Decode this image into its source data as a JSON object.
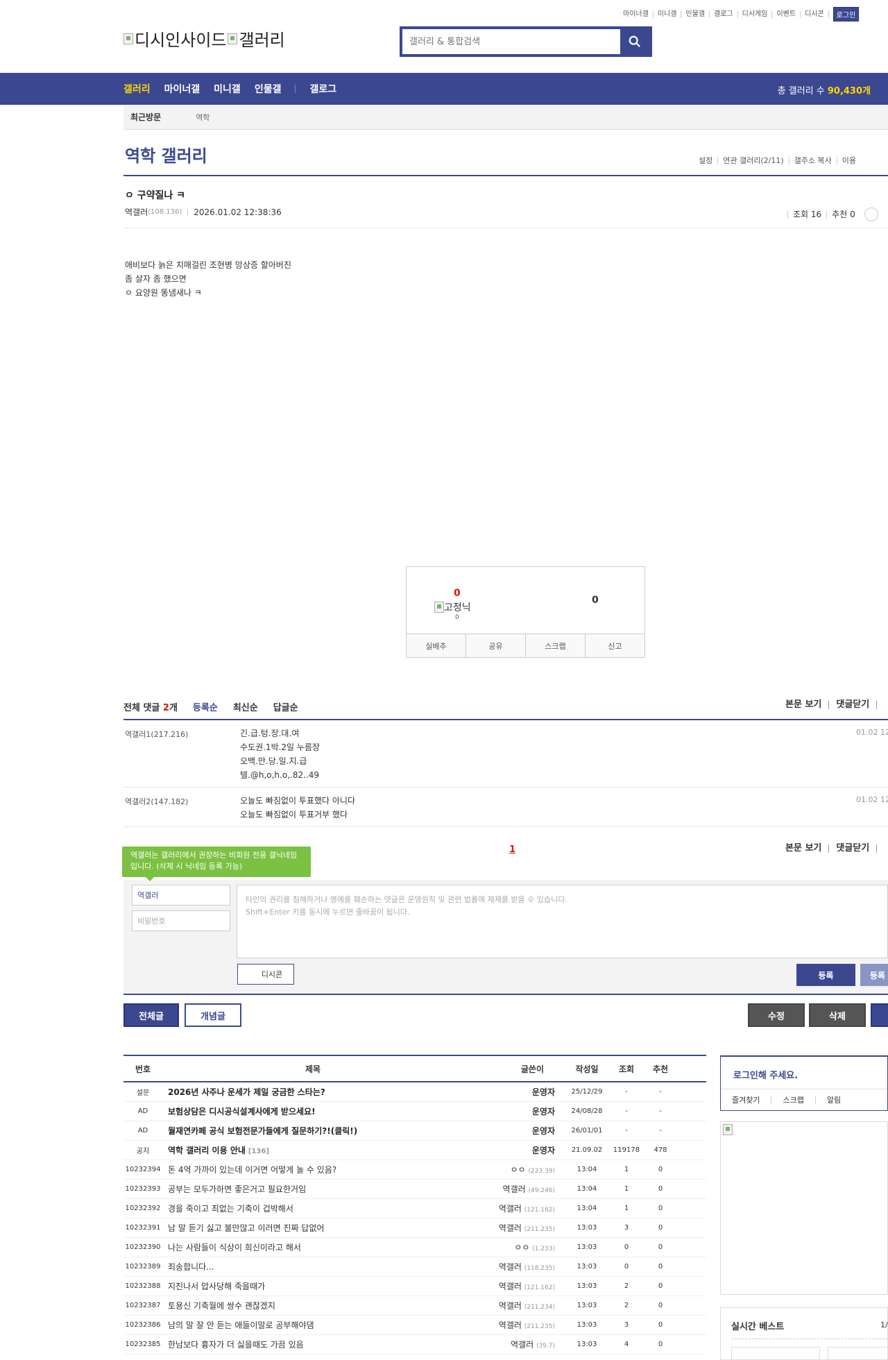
{
  "top_links": [
    "마이너갤",
    "미니갤",
    "인물갤",
    "갤로그",
    "디시게임",
    "이벤트",
    "디시콘"
  ],
  "login_label": "로그인",
  "logo": {
    "alt1": "디시인사이드",
    "alt2": "갤러리"
  },
  "search": {
    "placeholder": "갤러리 & 통합검색"
  },
  "nav": {
    "items": [
      "갤러리",
      "마이너갤",
      "미니갤",
      "인물갤",
      "갤로그"
    ],
    "total_label": "총 갤러리 수",
    "total_value": "90,430개"
  },
  "subbar": {
    "recent": "최근방문",
    "item": "역학"
  },
  "gallery": {
    "title": "역학 갤러리",
    "menu": [
      "설정",
      "연관 갤러리(2/11)",
      "갤주소 복사",
      "이용"
    ]
  },
  "post": {
    "title": "ㅇ 구약질나 ㅋ",
    "author": "역갤러",
    "ip": "(108.136)",
    "datetime": "2026.01.02 12:38:36",
    "views": "조회 16",
    "recommend": "추천 0",
    "body": [
      "애비보다 늙은 치매걸린 조현병 망상증 할아버진",
      "좀 살자 좀 했으면",
      "ㅇ  요양원 똥냄새나 ㅋ"
    ]
  },
  "recommend_box": {
    "up": "0",
    "fixnick_alt": "고정닉",
    "fixnick_count": "0",
    "down": "0",
    "buttons": [
      "실베추",
      "공유",
      "스크랩",
      "신고"
    ]
  },
  "comments_header": {
    "total_prefix": "전체 댓글",
    "total_count": "2",
    "total_suffix": "개",
    "sorts": [
      "등록순",
      "최신순",
      "답글순"
    ],
    "right": [
      "본문 보기",
      "댓글닫기"
    ]
  },
  "comments": [
    {
      "nick": "역갤러1",
      "ip": "(217.216)",
      "lines": [
        "긴.급.텅.장.대.여",
        "수도권.1박.2일 누름장",
        "오백.만.당.일.지.급",
        "텔.@h,o,h.o,.82..49"
      ],
      "date": "01.02 12"
    },
    {
      "nick": "역갤러2",
      "ip": "(147.182)",
      "lines": [
        "오늘도 빠짐없이 투표했다 아니다",
        "오늘도 빠짐없이 투표거부 했다"
      ],
      "date": "01.02 12"
    }
  ],
  "comment_pager": "1",
  "comment_footer_right": [
    "본문 보기",
    "댓글닫기"
  ],
  "write": {
    "tip": "역갤러는 갤러리에서 권장하는 비회원 전용 갤닉네임입니다. (삭제 시 닉네임 등록 가능)",
    "nick_value": "역갤러",
    "password_placeholder": "비밀번호",
    "textarea_line1": "타인의 권리를 침해하거나 명예를 훼손하는 댓글은 운영원칙 및 관련 법률에 제재를 받을 수 있습니다.",
    "textarea_line2": "Shift+Enter 키를 동시에 누르면 줄바꿈이 됩니다.",
    "dcon": "디시콘",
    "register": "등록",
    "register2": "등록"
  },
  "bottom_buttons": {
    "all": "전체글",
    "concept": "개념글",
    "edit": "수정",
    "delete": "삭제"
  },
  "list": {
    "headers": {
      "no": "번호",
      "title": "제목",
      "writer": "글쓴이",
      "date": "작성일",
      "views": "조회",
      "rec": "추천"
    },
    "rows": [
      {
        "no": "설문",
        "title": "2026년 사주나 운세가 제일 궁금한 스타는?",
        "count": "",
        "writer": "운영자",
        "ip": "",
        "date": "25/12/29",
        "views": "-",
        "rec": "-",
        "notice": true
      },
      {
        "no": "AD",
        "title": "보험상담은 디시공식설계사에게 받으세요!",
        "count": "",
        "writer": "운영자",
        "ip": "",
        "date": "24/08/28",
        "views": "-",
        "rec": "-",
        "notice": true
      },
      {
        "no": "AD",
        "title": "월재연카페 공식 보험전문가들에게 질문하기?!(클릭!)",
        "count": "",
        "writer": "운영자",
        "ip": "",
        "date": "26/01/01",
        "views": "-",
        "rec": "-",
        "notice": true
      },
      {
        "no": "공지",
        "title": "역학 갤러리 이용 안내",
        "count": "[136]",
        "writer": "운영자",
        "ip": "",
        "date": "21.09.02",
        "views": "119178",
        "rec": "478",
        "notice": true
      },
      {
        "no": "10232394",
        "title": "돈 4억 가까이 있는데 이거면 어떻게 놀 수 있음?",
        "count": "",
        "writer": "ㅇㅇ",
        "ip": "(223.39)",
        "date": "13:04",
        "views": "1",
        "rec": "0",
        "notice": false
      },
      {
        "no": "10232393",
        "title": "공부는 모두가하면 좋은거고 필요한거임",
        "count": "",
        "writer": "역갤러",
        "ip": "(49.246)",
        "date": "13:04",
        "views": "1",
        "rec": "0",
        "notice": false
      },
      {
        "no": "10232392",
        "title": "경을 죽이고 죄없는 기축이 겁박해서",
        "count": "",
        "writer": "역갤러",
        "ip": "(121.162)",
        "date": "13:04",
        "views": "1",
        "rec": "0",
        "notice": false
      },
      {
        "no": "10232391",
        "title": "남 말 듣기 싫고 불만많고 이러면 진짜 답없어",
        "count": "",
        "writer": "역갤러",
        "ip": "(211.235)",
        "date": "13:03",
        "views": "3",
        "rec": "0",
        "notice": false
      },
      {
        "no": "10232390",
        "title": "나는 사람들이 식상이 희신이라고 해서",
        "count": "",
        "writer": "ㅇㅇ",
        "ip": "(1.233)",
        "date": "13:03",
        "views": "0",
        "rec": "0",
        "notice": false
      },
      {
        "no": "10232389",
        "title": "죄송합니다...",
        "count": "",
        "writer": "역갤러",
        "ip": "(118.235)",
        "date": "13:03",
        "views": "0",
        "rec": "0",
        "notice": false
      },
      {
        "no": "10232388",
        "title": "지진나서 압사당해 죽을때가",
        "count": "",
        "writer": "역갤러",
        "ip": "(121.162)",
        "date": "13:03",
        "views": "2",
        "rec": "0",
        "notice": false
      },
      {
        "no": "10232387",
        "title": "토용신 기축월에 쌍수 괜찮겠지",
        "count": "",
        "writer": "역갤러",
        "ip": "(211.234)",
        "date": "13:03",
        "views": "2",
        "rec": "0",
        "notice": false
      },
      {
        "no": "10232386",
        "title": "남의 말 잘 안 듣는 애들이말로 공부해야댐",
        "count": "",
        "writer": "역갤러",
        "ip": "(211.235)",
        "date": "13:03",
        "views": "3",
        "rec": "0",
        "notice": false
      },
      {
        "no": "10232385",
        "title": "한남보다 흉자가 더 싫을때도 가끔 있음",
        "count": "",
        "writer": "역갤러",
        "ip": "(39.7)",
        "date": "13:03",
        "views": "4",
        "rec": "0",
        "notice": false
      }
    ]
  },
  "side": {
    "login_title": "로그인해 주세요.",
    "login_tabs": [
      "즐겨찾기",
      "스크랩",
      "알림"
    ],
    "best_title": "실시간 베스트",
    "best_page": "1/"
  },
  "colors": {
    "brand": "#3b4890",
    "accent_yellow": "#ffd600",
    "accent_red": "#d31900",
    "tip_green": "#7bc142"
  }
}
